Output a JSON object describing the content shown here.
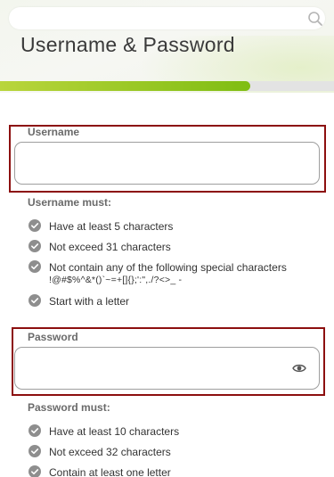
{
  "header": {
    "search": {
      "value": "",
      "placeholder": ""
    },
    "title": "Username & Password",
    "progress": {
      "percent": 75
    }
  },
  "username": {
    "label": "Username",
    "value": "",
    "rules_heading": "Username must:",
    "rules": [
      {
        "text": "Have at least 5 characters"
      },
      {
        "text": "Not exceed 31 characters"
      },
      {
        "text": "Not contain any of the following special characters",
        "chars": "!@#$%^&*()`~=+[]{};':\",./?<>_ -"
      },
      {
        "text": "Start with a letter"
      }
    ]
  },
  "password": {
    "label": "Password",
    "value": "",
    "rules_heading": "Password must:",
    "rules": [
      {
        "text": "Have at least 10 characters"
      },
      {
        "text": "Not exceed 32 characters"
      },
      {
        "text": "Contain at least one letter"
      }
    ]
  },
  "icons": {
    "search": "search-icon",
    "check": "check-circle-icon",
    "visibility": "eye-icon"
  },
  "colors": {
    "accent_start": "#b9d53c",
    "accent_end": "#7fbd12",
    "highlight": "#8c0f0f",
    "check": "#8e8e8e"
  }
}
